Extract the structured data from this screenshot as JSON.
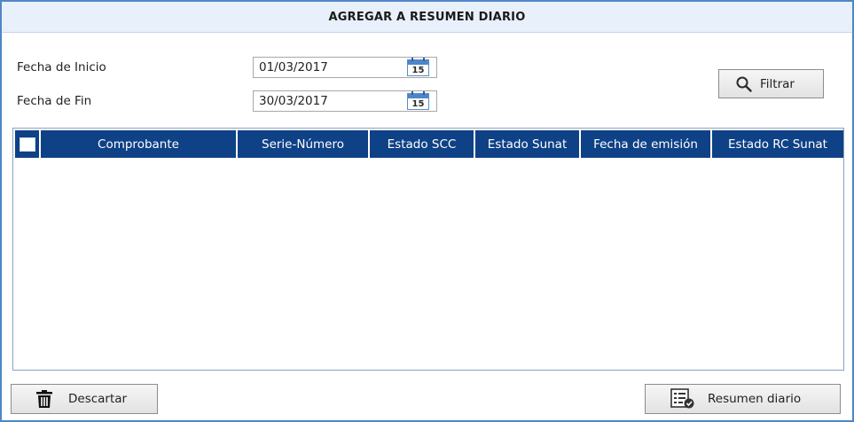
{
  "window": {
    "title": "AGREGAR A RESUMEN DIARIO"
  },
  "filters": {
    "start_label": "Fecha de Inicio",
    "start_value": "01/03/2017",
    "end_label": "Fecha de Fin",
    "end_value": "30/03/2017",
    "calendar_day": "15",
    "filter_button": "Filtrar"
  },
  "grid": {
    "columns": [
      "Comprobante",
      "Serie-Número",
      "Estado SCC",
      "Estado Sunat",
      "Fecha de emisión",
      "Estado RC Sunat"
    ],
    "rows": []
  },
  "footer": {
    "discard_button": "Descartar",
    "summary_button": "Resumen diario"
  },
  "colors": {
    "header_bg": "#0f4186",
    "window_border": "#4f86c6",
    "titlebar_bg": "#e8f0fb"
  },
  "icons": {
    "filter": "search-icon",
    "date": "calendar-icon",
    "discard": "trash-icon",
    "summary": "summary-list-icon"
  }
}
